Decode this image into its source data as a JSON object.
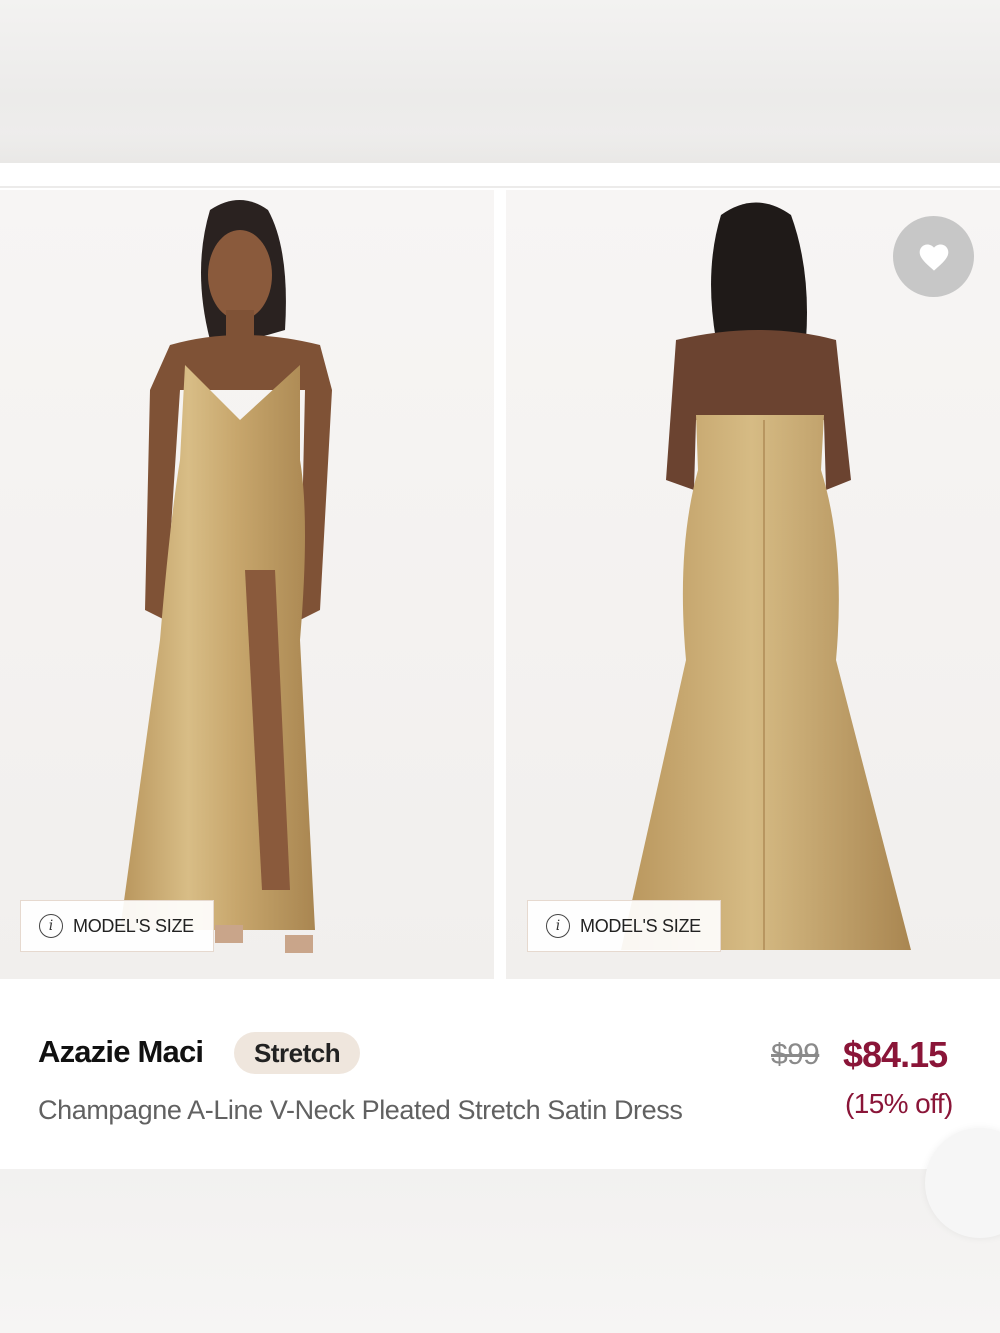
{
  "product": {
    "brand": "Azazie Maci",
    "badge": "Stretch",
    "name": "Champagne A-Line V-Neck Pleated Stretch Satin Dress",
    "original_price": "$99",
    "sale_price": "$84.15",
    "discount": "(15% off)"
  },
  "gallery": {
    "front_model_size_label": "MODEL'S SIZE",
    "back_model_size_label": "MODEL'S SIZE"
  },
  "icons": {
    "favorite": "heart-icon",
    "info": "info-icon"
  },
  "colors": {
    "sale_price": "#8a1538",
    "badge_bg": "#efe6dd",
    "dress": "#c9a96e"
  }
}
